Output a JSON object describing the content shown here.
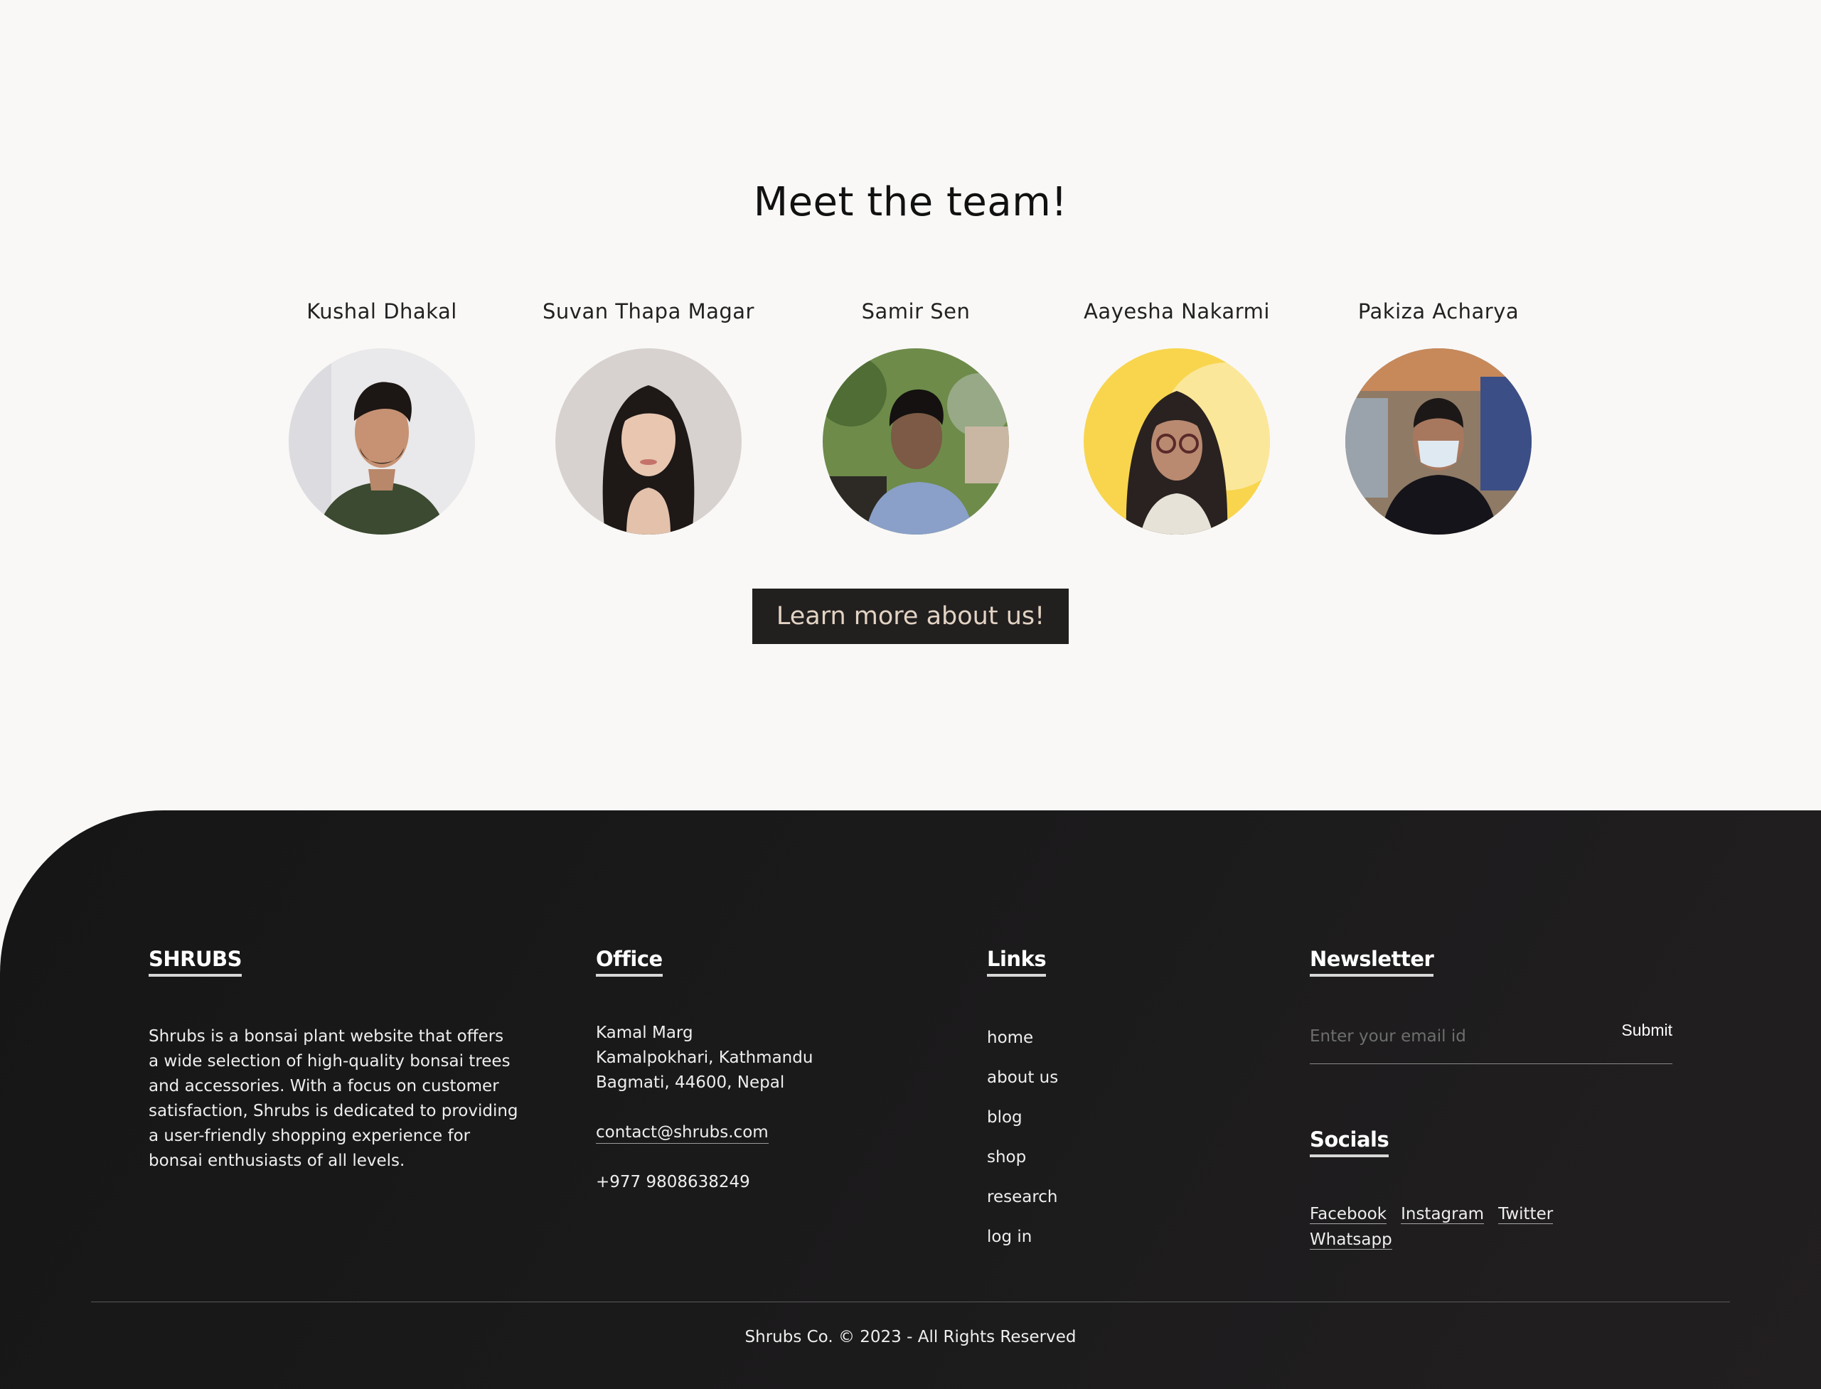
{
  "team": {
    "title": "Meet the team!",
    "members": [
      {
        "name": "Kushal Dhakal"
      },
      {
        "name": "Suvan Thapa Magar"
      },
      {
        "name": "Samir Sen"
      },
      {
        "name": "Aayesha Nakarmi"
      },
      {
        "name": "Pakiza Acharya"
      }
    ],
    "cta_label": "Learn more about us!"
  },
  "footer": {
    "brand": {
      "heading": "SHRUBS",
      "description": "Shrubs is a bonsai plant website that offers a wide selection of high-quality bonsai trees and accessories. With a focus on customer satisfaction, Shrubs is dedicated to providing a user-friendly shopping experience for bonsai enthusiasts of all levels."
    },
    "office": {
      "heading": "Office",
      "address_line1": "Kamal Marg",
      "address_line2": "Kamalpokhari, Kathmandu",
      "address_line3": "Bagmati, 44600, Nepal",
      "email": "contact@shrubs.com",
      "phone": "+977 9808638249"
    },
    "links": {
      "heading": "Links",
      "items": [
        "home",
        "about us",
        "blog",
        "shop",
        "research",
        "log in"
      ]
    },
    "newsletter": {
      "heading": "Newsletter",
      "email_placeholder": "Enter your email id",
      "email_value": "",
      "submit_label": "Submit"
    },
    "socials": {
      "heading": "Socials",
      "items": [
        "Facebook",
        "Instagram",
        "Twitter",
        "Whatsapp"
      ]
    },
    "copyright": "Shrubs Co. © 2023 - All Rights Reserved"
  },
  "colors": {
    "page_background": "#f9f8f6",
    "footer_background": "#1c1b1c",
    "button_background": "#221f1f",
    "button_text": "#e2d3c3"
  }
}
